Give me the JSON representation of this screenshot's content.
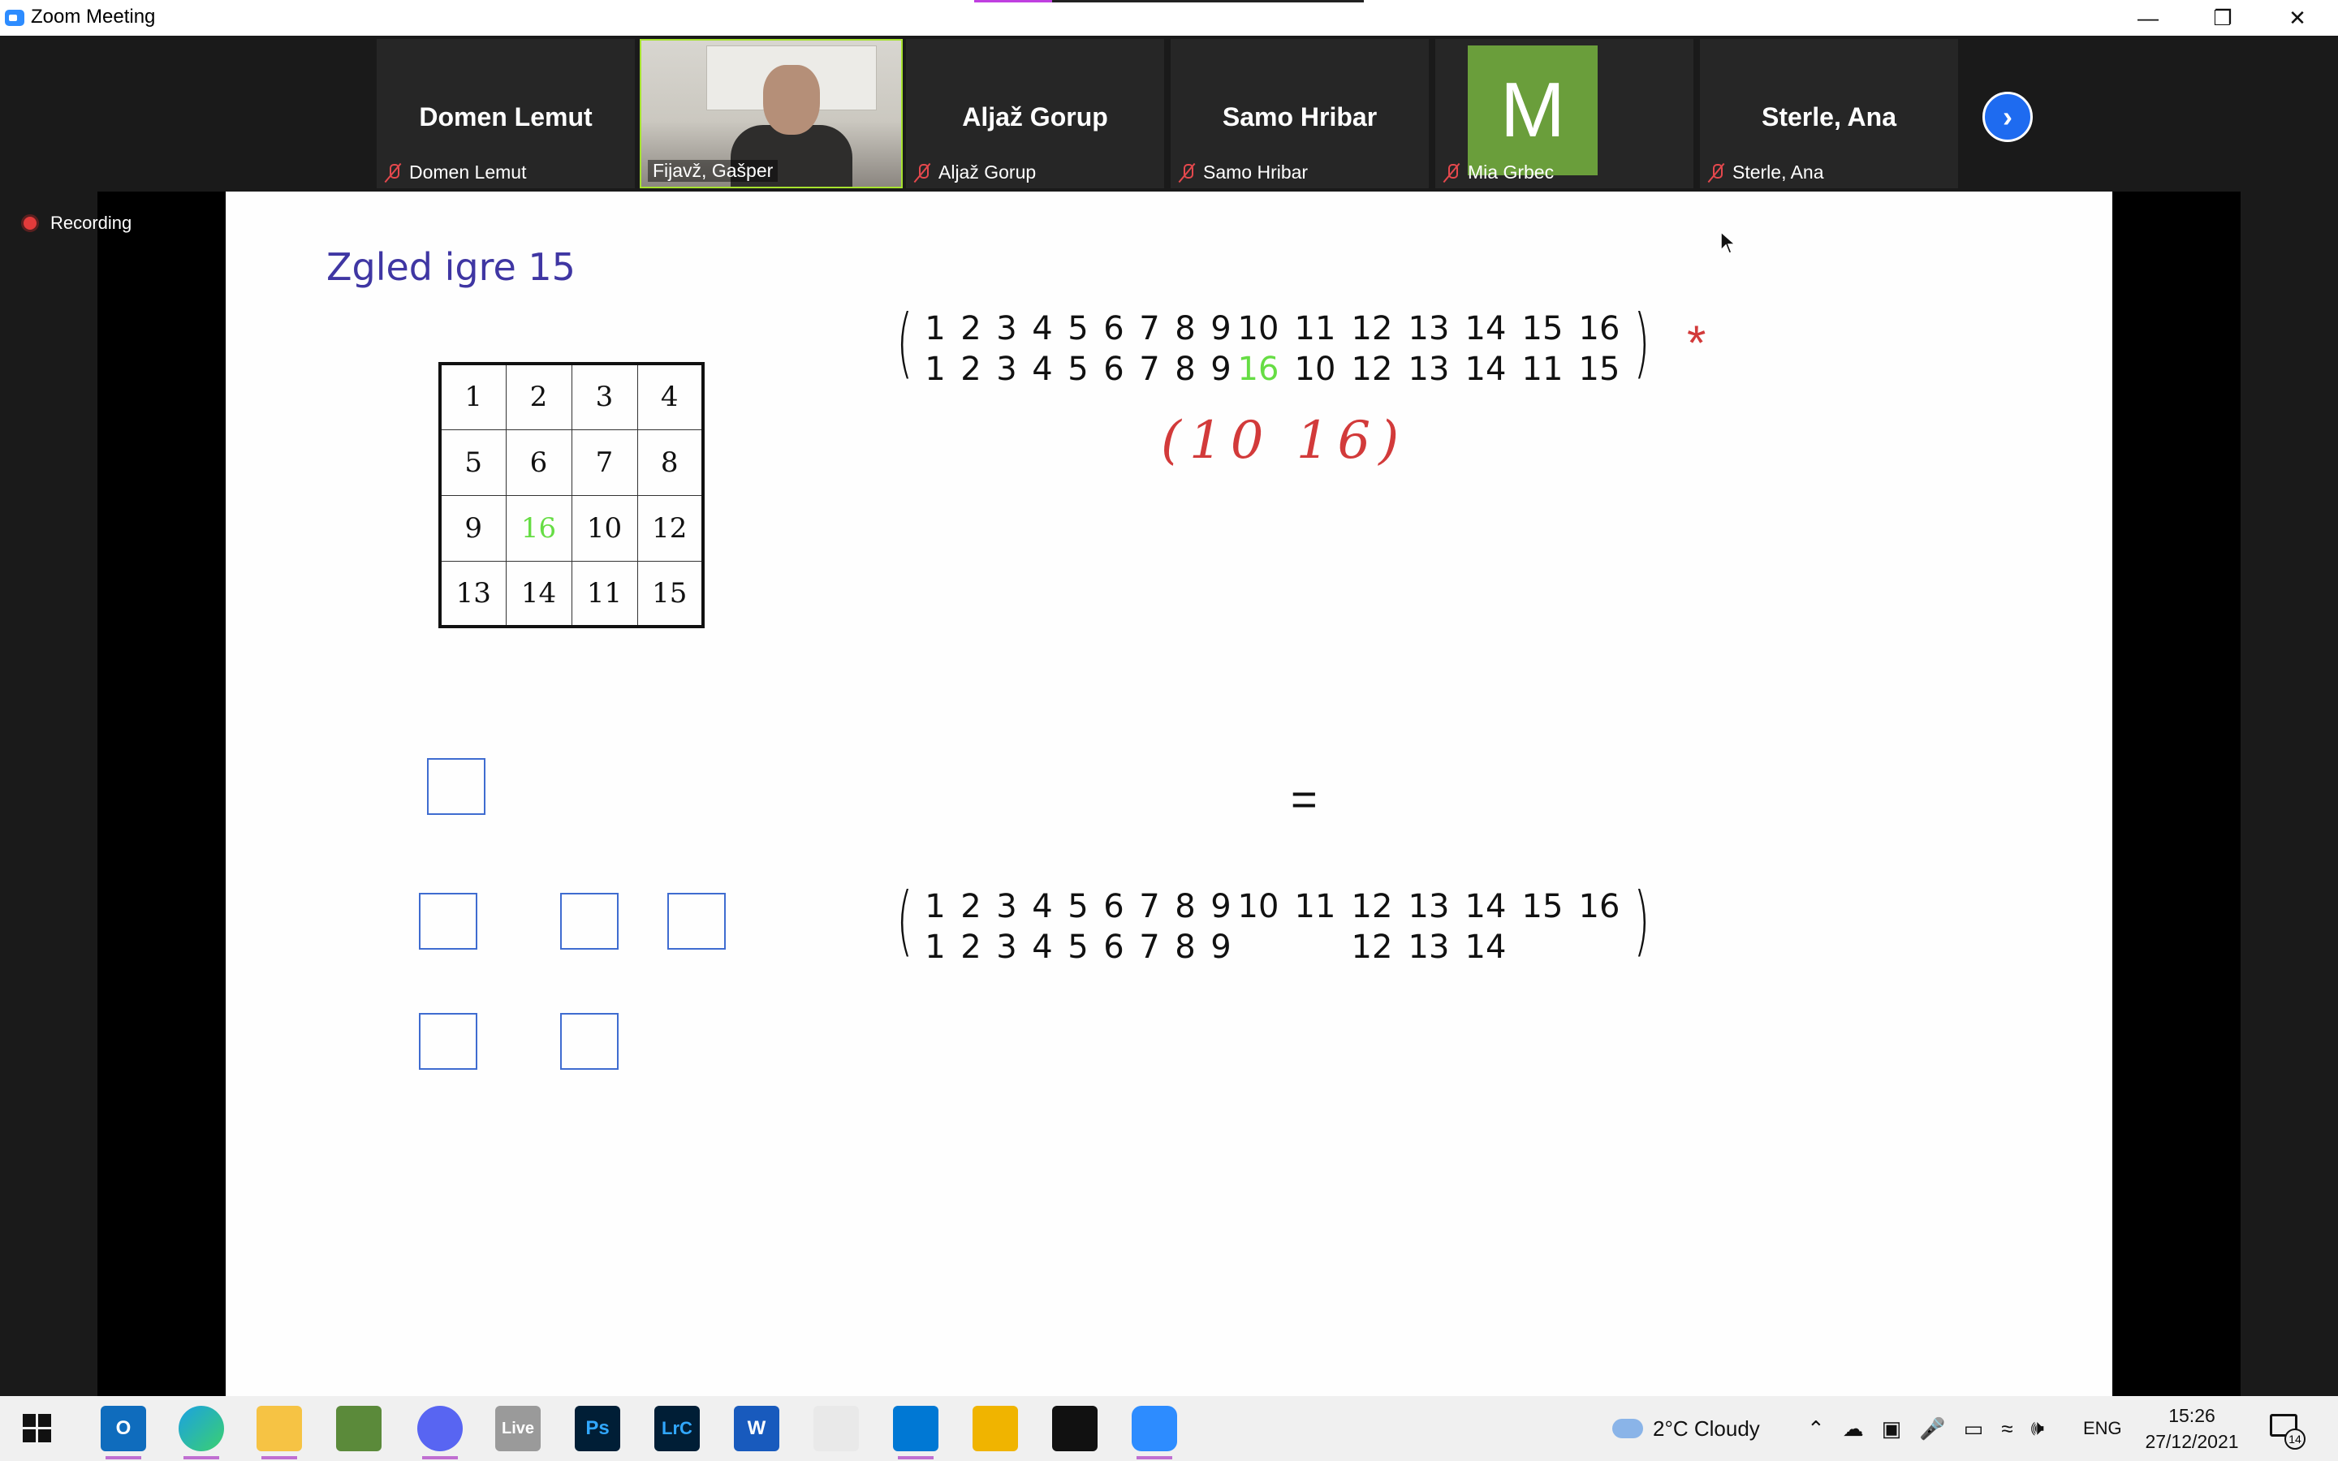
{
  "window": {
    "title": "Zoom Meeting"
  },
  "participants": [
    {
      "name": "Domen Lemut",
      "label": "Domen Lemut"
    },
    {
      "name": "",
      "label": "Fijavž, Gašper"
    },
    {
      "name": "Aljaž Gorup",
      "label": "Aljaž Gorup"
    },
    {
      "name": "Samo Hribar",
      "label": "Samo Hribar"
    },
    {
      "name": "M",
      "label": "Mia Grbec"
    },
    {
      "name": "Sterle, Ana",
      "label": "Sterle, Ana"
    }
  ],
  "recording_label": "Recording",
  "slide": {
    "title": "Zgled igre 15",
    "grid": [
      [
        "1",
        "2",
        "3",
        "4"
      ],
      [
        "5",
        "6",
        "7",
        "8"
      ],
      [
        "9",
        "16",
        "10",
        "12"
      ],
      [
        "13",
        "14",
        "11",
        "15"
      ]
    ],
    "perm_top": {
      "row1": [
        "1",
        "2",
        "3",
        "4",
        "5",
        "6",
        "7",
        "8",
        "9",
        "10",
        "11",
        "12",
        "13",
        "14",
        "15",
        "16"
      ],
      "row2": [
        "1",
        "2",
        "3",
        "4",
        "5",
        "6",
        "7",
        "8",
        "9",
        "16",
        "10",
        "12",
        "13",
        "14",
        "11",
        "15"
      ]
    },
    "handwritten_note": "(10  16)",
    "star": "*",
    "equals": "=",
    "perm_bottom": {
      "row1": [
        "1",
        "2",
        "3",
        "4",
        "5",
        "6",
        "7",
        "8",
        "9",
        "10",
        "11",
        "12",
        "13",
        "14",
        "15",
        "16"
      ],
      "row2": [
        "1",
        "2",
        "3",
        "4",
        "5",
        "6",
        "7",
        "8",
        "9",
        "",
        "",
        "12",
        "13",
        "14",
        "",
        ""
      ]
    }
  },
  "taskbar": {
    "weather": "2°C  Cloudy",
    "language": "ENG",
    "time": "15:26",
    "date": "27/12/2021",
    "notifications": "14",
    "apps": [
      "Live",
      "Ps",
      "LrC",
      "W"
    ]
  },
  "colors": {
    "zoom_blue": "#2d8cff",
    "mute_red": "#e5484d",
    "active_speaker": "#a6e22e",
    "slide_title": "#3f36a3",
    "highlight_green": "#66dd44",
    "annotation_red": "#d23a3a"
  }
}
